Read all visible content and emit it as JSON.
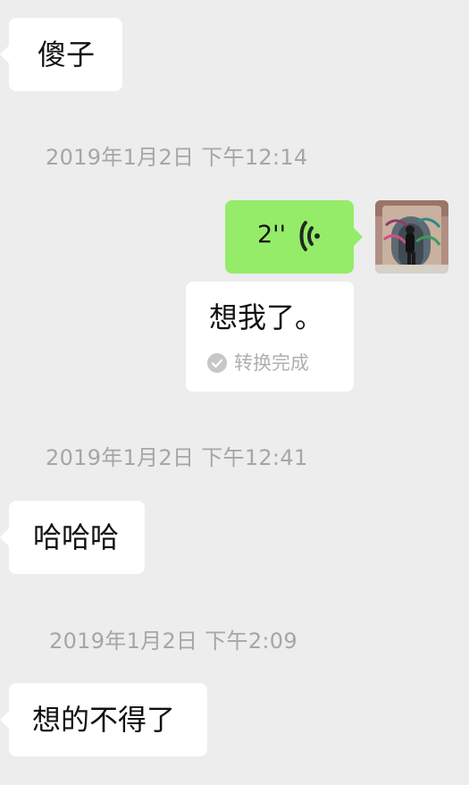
{
  "conversation": {
    "messages": [
      {
        "text": "傻子"
      },
      {
        "text": "哈哈哈"
      },
      {
        "text": "想的不得了"
      }
    ],
    "timestamps": [
      "2019年1月2日 下午12:14",
      "2019年1月2日 下午12:41",
      "2019年1月2日 下午2:09"
    ],
    "voice_message": {
      "duration": "2''",
      "icon": "voice-wave-icon"
    },
    "transcript": {
      "text": "想我了。",
      "status": "转换完成",
      "icon": "check-circle-icon"
    }
  },
  "colors": {
    "background": "#ededed",
    "incoming_bubble": "#ffffff",
    "outgoing_bubble": "#95ec69",
    "timestamp_text": "#a6a6a6"
  }
}
